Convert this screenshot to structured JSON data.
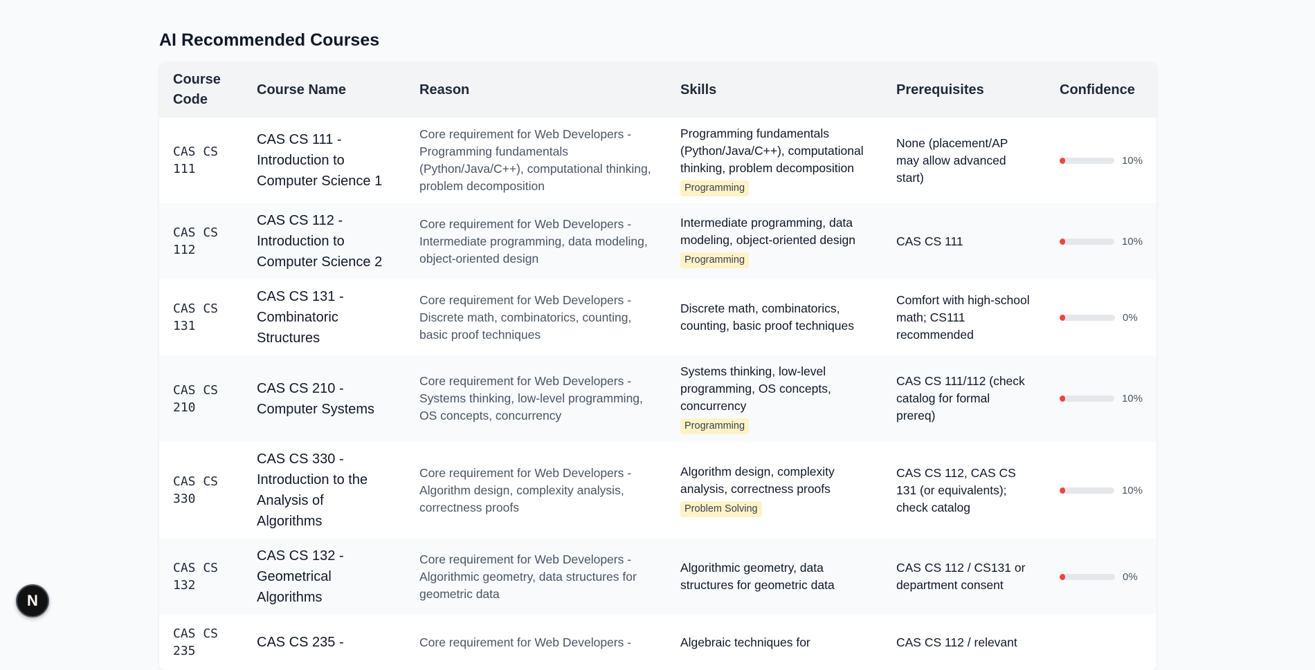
{
  "page": {
    "title": "AI Recommended Courses"
  },
  "table": {
    "headers": [
      "Course Code",
      "Course Name",
      "Reason",
      "Skills",
      "Prerequisites",
      "Confidence"
    ],
    "rows": [
      {
        "code": "CAS CS 111",
        "name": "CAS CS 111 - Introduction to Computer Science 1",
        "reason": "Core requirement for Web Developers - Programming fundamentals (Python/Java/C++), computational thinking, problem decomposition",
        "skills": "Programming fundamentals (Python/Java/C++), computational thinking, problem decomposition",
        "tag": "Programming",
        "prereq": "None (placement/AP may allow advanced start)",
        "confidence_label": "10%",
        "confidence": 0.1
      },
      {
        "code": "CAS CS 112",
        "name": "CAS CS 112 - Introduction to Computer Science 2",
        "reason": "Core requirement for Web Developers - Intermediate programming, data modeling, object-oriented design",
        "skills": "Intermediate programming, data modeling, object-oriented design",
        "tag": "Programming",
        "prereq": "CAS CS 111",
        "confidence_label": "10%",
        "confidence": 0.1
      },
      {
        "code": "CAS CS 131",
        "name": "CAS CS 131 - Combinatoric Structures",
        "reason": "Core requirement for Web Developers - Discrete math, combinatorics, counting, basic proof techniques",
        "skills": "Discrete math, combinatorics, counting, basic proof techniques",
        "tag": "",
        "prereq": "Comfort with high-school math; CS111 recommended",
        "confidence_label": "0%",
        "confidence": 0.0
      },
      {
        "code": "CAS CS 210",
        "name": "CAS CS 210 - Computer Systems",
        "reason": "Core requirement for Web Developers - Systems thinking, low-level programming, OS concepts, concurrency",
        "skills": "Systems thinking, low-level programming, OS concepts, concurrency",
        "tag": "Programming",
        "prereq": "CAS CS 111/112 (check catalog for formal prereq)",
        "confidence_label": "10%",
        "confidence": 0.1
      },
      {
        "code": "CAS CS 330",
        "name": "CAS CS 330 - Introduction to the Analysis of Algorithms",
        "reason": "Core requirement for Web Developers - Algorithm design, complexity analysis, correctness proofs",
        "skills": "Algorithm design, complexity analysis, correctness proofs",
        "tag": "Problem Solving",
        "prereq": "CAS CS 112, CAS CS 131 (or equivalents); check catalog",
        "confidence_label": "10%",
        "confidence": 0.1
      },
      {
        "code": "CAS CS 132",
        "name": "CAS CS 132 - Geometrical Algorithms",
        "reason": "Core requirement for Web Developers - Algorithmic geometry, data structures for geometric data",
        "skills": "Algorithmic geometry, data structures for geometric data",
        "tag": "",
        "prereq": "CAS CS 112 / CS131 or department consent",
        "confidence_label": "0%",
        "confidence": 0.0
      },
      {
        "code": "CAS CS 235",
        "name": "CAS CS 235 -",
        "reason": "Core requirement for Web Developers -",
        "skills": "Algebraic techniques for",
        "tag": "",
        "prereq": "CAS CS 112 / relevant",
        "confidence_label": "",
        "confidence": 0.0
      }
    ]
  },
  "fab": {
    "label": "N"
  }
}
